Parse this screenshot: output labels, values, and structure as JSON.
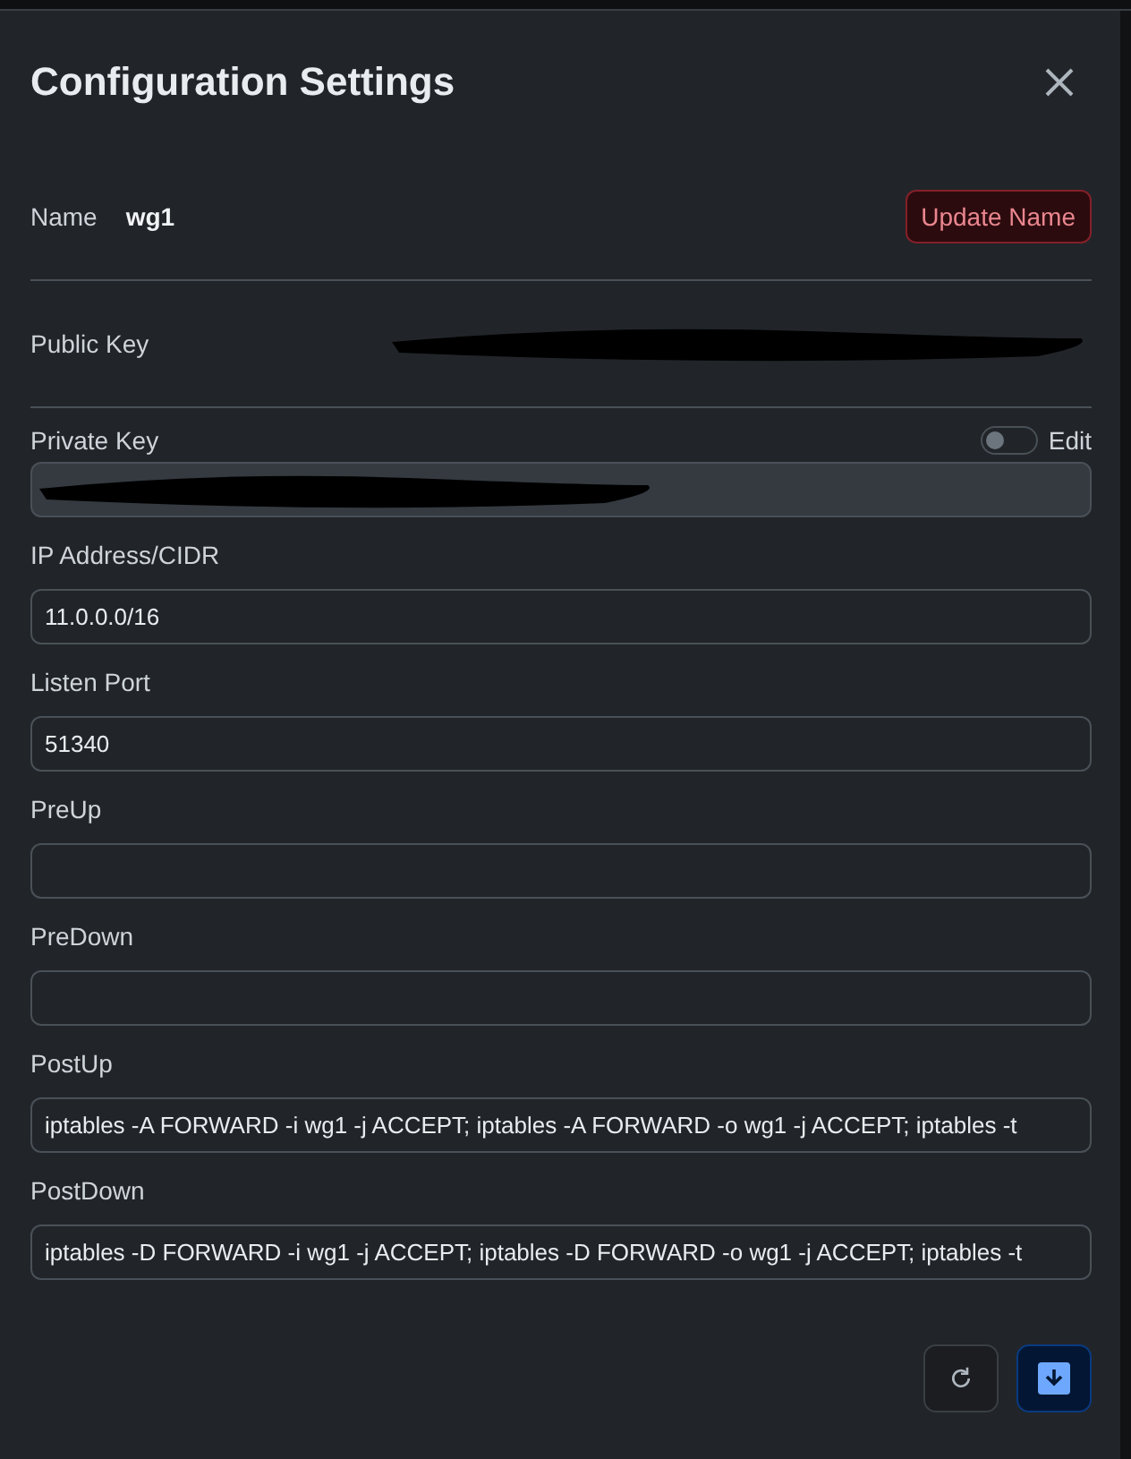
{
  "dialog": {
    "title": "Configuration Settings"
  },
  "name": {
    "label": "Name",
    "value": "wg1",
    "button": "Update Name"
  },
  "public_key": {
    "label": "Public Key",
    "redacted": true
  },
  "private_key": {
    "label": "Private Key",
    "toggle_label": "Edit",
    "editable": false,
    "redacted": true
  },
  "fields": [
    {
      "label": "IP Address/CIDR",
      "value": "11.0.0.0/16"
    },
    {
      "label": "Listen Port",
      "value": "51340"
    },
    {
      "label": "PreUp"
    },
    {
      "label": "PreDown"
    },
    {
      "label": "PostUp",
      "value": "iptables -A FORWARD -i wg1 -j ACCEPT; iptables -A FORWARD -o wg1 -j ACCEPT; iptables -t"
    },
    {
      "label": "PostDown",
      "value": "iptables -D FORWARD -i wg1 -j ACCEPT; iptables -D FORWARD -o wg1 -j ACCEPT; iptables -t"
    }
  ]
}
